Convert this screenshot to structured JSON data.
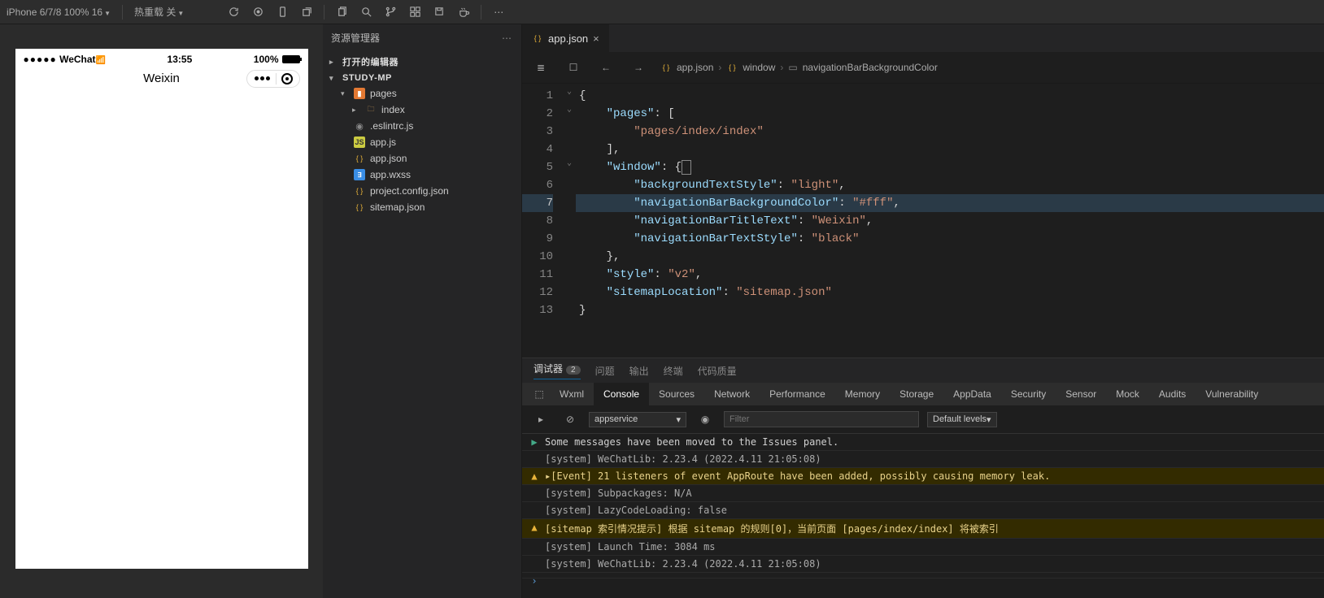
{
  "topbar": {
    "device_label": "iPhone 6/7/8 100% 16",
    "hot_reload_label": "热重载 关"
  },
  "simulator": {
    "carrier": "WeChat",
    "time": "13:55",
    "battery_pct": "100%",
    "page_title": "Weixin"
  },
  "explorer": {
    "title": "资源管理器",
    "open_editors": "打开的编辑器",
    "project": "STUDY-MP",
    "tree": {
      "pages_folder": "pages",
      "index_folder": "index",
      "files": [
        ".eslintrc.js",
        "app.js",
        "app.json",
        "app.wxss",
        "project.config.json",
        "sitemap.json"
      ]
    }
  },
  "editor": {
    "tab_label": "app.json",
    "breadcrumb": {
      "file": "app.json",
      "sep": "›",
      "seg_window": "window",
      "seg_prop": "navigationBarBackgroundColor"
    },
    "gutter": [
      "1",
      "2",
      "3",
      "4",
      "5",
      "6",
      "7",
      "8",
      "9",
      "10",
      "11",
      "12",
      "13"
    ],
    "code": {
      "l1": "{",
      "l2_key": "\"pages\"",
      "l2_rest": ": [",
      "l3_val": "\"pages/index/index\"",
      "l4": "],",
      "l5_key": "\"window\"",
      "l5_rest": ": {",
      "l6_key": "\"backgroundTextStyle\"",
      "l6_val": "\"light\"",
      "l7_key": "\"navigationBarBackgroundColor\"",
      "l7_val": "\"#fff\"",
      "l8_key": "\"navigationBarTitleText\"",
      "l8_val": "\"Weixin\"",
      "l9_key": "\"navigationBarTextStyle\"",
      "l9_val": "\"black\"",
      "l10": "},",
      "l11_key": "\"style\"",
      "l11_val": "\"v2\"",
      "l12_key": "\"sitemapLocation\"",
      "l12_val": "\"sitemap.json\"",
      "l13": "}"
    }
  },
  "bottom_tabs": {
    "debugger": "调试器",
    "debugger_badge": "2",
    "problems": "问题",
    "output": "输出",
    "terminal": "终端",
    "code_quality": "代码质量"
  },
  "devtools": {
    "tabs": [
      "Wxml",
      "Console",
      "Sources",
      "Network",
      "Performance",
      "Memory",
      "Storage",
      "AppData",
      "Security",
      "Sensor",
      "Mock",
      "Audits",
      "Vulnerability"
    ],
    "active_tab": "Console",
    "context": "appservice",
    "filter_placeholder": "Filter",
    "levels": "Default levels"
  },
  "console": [
    {
      "type": "info",
      "glyph": "▶",
      "text": "Some messages have been moved to the Issues panel."
    },
    {
      "type": "sys",
      "glyph": "",
      "text": "[system] WeChatLib: 2.23.4 (2022.4.11 21:05:08)"
    },
    {
      "type": "warn",
      "glyph": "▲",
      "text": "▸[Event] 21 listeners of event AppRoute have been added, possibly causing memory leak."
    },
    {
      "type": "sys",
      "glyph": "",
      "text": "[system] Subpackages: N/A"
    },
    {
      "type": "sys",
      "glyph": "",
      "text": "[system] LazyCodeLoading: false"
    },
    {
      "type": "warn",
      "glyph": "▲",
      "text": "[sitemap 索引情况提示] 根据 sitemap 的规则[0]，当前页面 [pages/index/index] 将被索引"
    },
    {
      "type": "sys",
      "glyph": "",
      "text": "[system] Launch Time: 3084 ms"
    },
    {
      "type": "sys",
      "glyph": "",
      "text": "[system] WeChatLib: 2.23.4 (2022.4.11 21:05:08)"
    },
    {
      "type": "prompt",
      "glyph": "›",
      "text": ""
    }
  ],
  "chart_data": {
    "type": "table",
    "title": "app.json",
    "data": {
      "pages": [
        "pages/index/index"
      ],
      "window": {
        "backgroundTextStyle": "light",
        "navigationBarBackgroundColor": "#fff",
        "navigationBarTitleText": "Weixin",
        "navigationBarTextStyle": "black"
      },
      "style": "v2",
      "sitemapLocation": "sitemap.json"
    }
  }
}
